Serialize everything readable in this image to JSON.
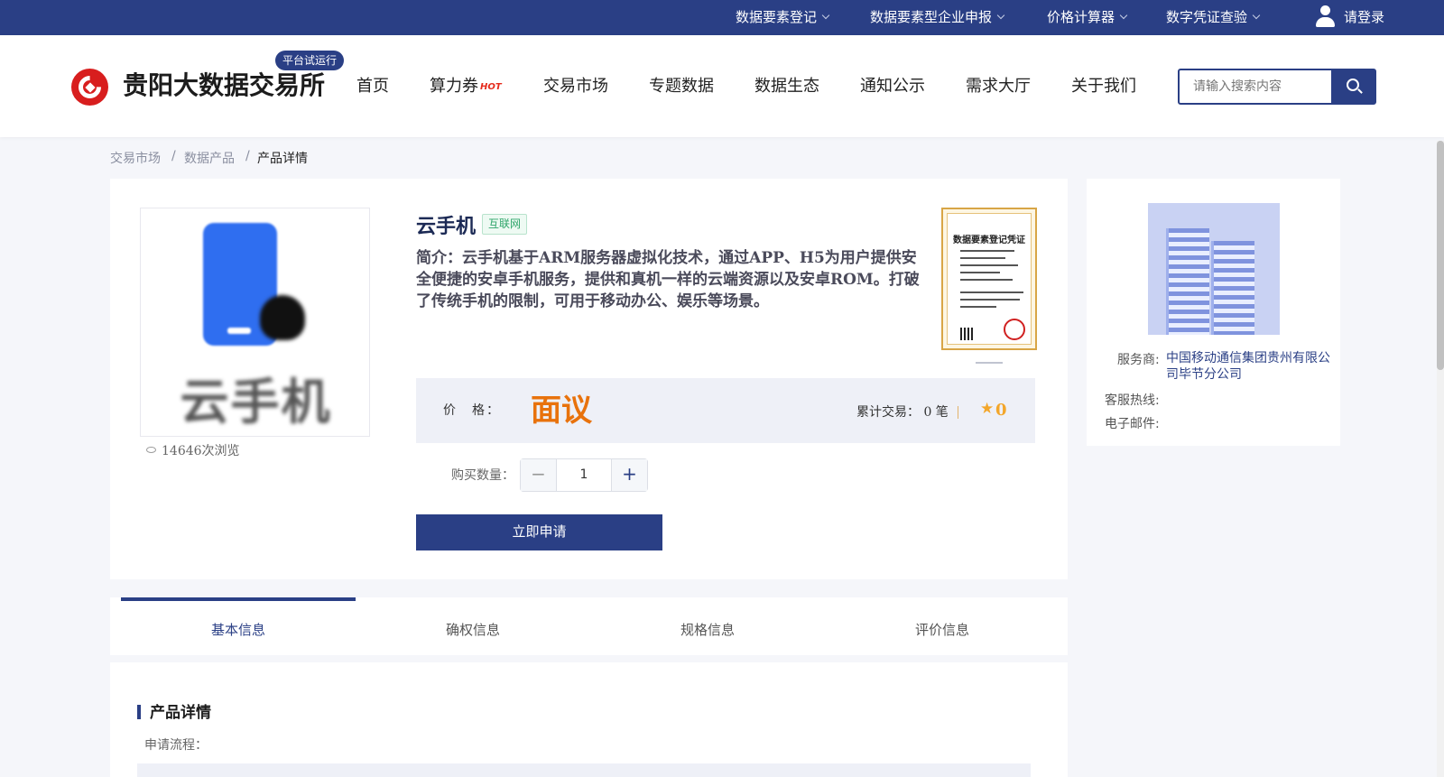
{
  "topbar": {
    "links": [
      "数据要素登记",
      "数据要素型企业申报",
      "价格计算器",
      "数字凭证查验"
    ],
    "login": "请登录"
  },
  "header": {
    "brand": "贵阳大数据交易所",
    "badge": "平台试运行",
    "nav": [
      "首页",
      "算力券",
      "交易市场",
      "专题数据",
      "数据生态",
      "通知公示",
      "需求大厅",
      "关于我们"
    ],
    "hot_badge": "HOT",
    "search_placeholder": "请输入搜索内容"
  },
  "breadcrumb": [
    "交易市场",
    "数据产品",
    "产品详情"
  ],
  "product": {
    "thumb_text": "云手机",
    "views": "14646次浏览",
    "title": "云手机",
    "tag": "互联网",
    "description": "简介：云手机基于ARM服务器虚拟化技术，通过APP、H5为用户提供安全便捷的安卓手机服务，提供和真机一样的云端资源以及安卓ROM。打破了传统手机的限制，可用于移动办公、娱乐等场景。",
    "certificate_title": "数据要素登记凭证",
    "price_label": "价　格：",
    "price_value": "面议",
    "trades_label": "累计交易：",
    "trades_value": "0 笔",
    "rating": "0",
    "quantity_label": "购买数量：",
    "quantity": "1",
    "apply_button": "立即申请"
  },
  "provider": {
    "service_label": "服务商:",
    "service_value": "中国移动通信集团贵州有限公司毕节分公司",
    "hotline_label": "客服热线:",
    "email_label": "电子邮件:"
  },
  "tabs": [
    "基本信息",
    "确权信息",
    "规格信息",
    "评价信息"
  ],
  "detail": {
    "title": "产品详情",
    "sub": "申请流程："
  },
  "colors": {
    "primary": "#2a3f85",
    "price": "#e8720c",
    "star": "#f3a62a"
  }
}
